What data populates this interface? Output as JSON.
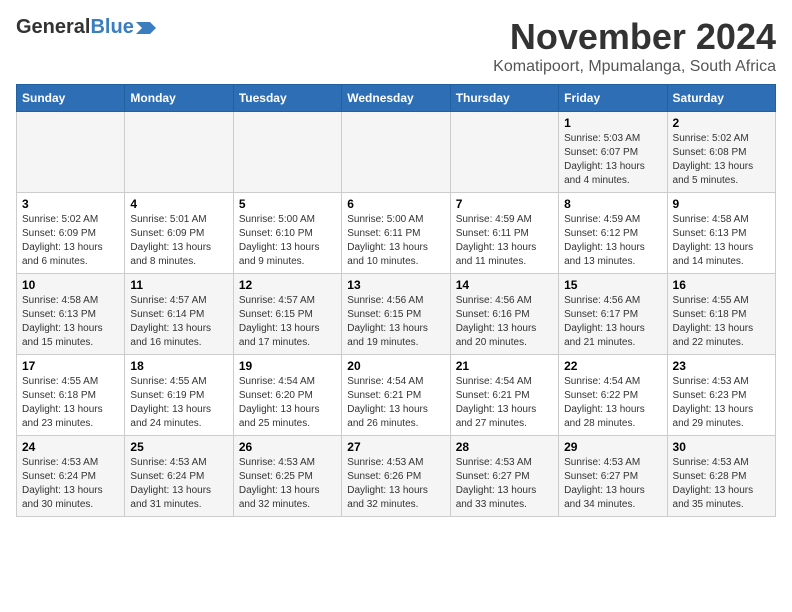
{
  "logo": {
    "part1": "General",
    "part2": "Blue"
  },
  "title": "November 2024",
  "subtitle": "Komatipoort, Mpumalanga, South Africa",
  "days_of_week": [
    "Sunday",
    "Monday",
    "Tuesday",
    "Wednesday",
    "Thursday",
    "Friday",
    "Saturday"
  ],
  "weeks": [
    [
      {
        "day": "",
        "detail": ""
      },
      {
        "day": "",
        "detail": ""
      },
      {
        "day": "",
        "detail": ""
      },
      {
        "day": "",
        "detail": ""
      },
      {
        "day": "",
        "detail": ""
      },
      {
        "day": "1",
        "detail": "Sunrise: 5:03 AM\nSunset: 6:07 PM\nDaylight: 13 hours\nand 4 minutes."
      },
      {
        "day": "2",
        "detail": "Sunrise: 5:02 AM\nSunset: 6:08 PM\nDaylight: 13 hours\nand 5 minutes."
      }
    ],
    [
      {
        "day": "3",
        "detail": "Sunrise: 5:02 AM\nSunset: 6:09 PM\nDaylight: 13 hours\nand 6 minutes."
      },
      {
        "day": "4",
        "detail": "Sunrise: 5:01 AM\nSunset: 6:09 PM\nDaylight: 13 hours\nand 8 minutes."
      },
      {
        "day": "5",
        "detail": "Sunrise: 5:00 AM\nSunset: 6:10 PM\nDaylight: 13 hours\nand 9 minutes."
      },
      {
        "day": "6",
        "detail": "Sunrise: 5:00 AM\nSunset: 6:11 PM\nDaylight: 13 hours\nand 10 minutes."
      },
      {
        "day": "7",
        "detail": "Sunrise: 4:59 AM\nSunset: 6:11 PM\nDaylight: 13 hours\nand 11 minutes."
      },
      {
        "day": "8",
        "detail": "Sunrise: 4:59 AM\nSunset: 6:12 PM\nDaylight: 13 hours\nand 13 minutes."
      },
      {
        "day": "9",
        "detail": "Sunrise: 4:58 AM\nSunset: 6:13 PM\nDaylight: 13 hours\nand 14 minutes."
      }
    ],
    [
      {
        "day": "10",
        "detail": "Sunrise: 4:58 AM\nSunset: 6:13 PM\nDaylight: 13 hours\nand 15 minutes."
      },
      {
        "day": "11",
        "detail": "Sunrise: 4:57 AM\nSunset: 6:14 PM\nDaylight: 13 hours\nand 16 minutes."
      },
      {
        "day": "12",
        "detail": "Sunrise: 4:57 AM\nSunset: 6:15 PM\nDaylight: 13 hours\nand 17 minutes."
      },
      {
        "day": "13",
        "detail": "Sunrise: 4:56 AM\nSunset: 6:15 PM\nDaylight: 13 hours\nand 19 minutes."
      },
      {
        "day": "14",
        "detail": "Sunrise: 4:56 AM\nSunset: 6:16 PM\nDaylight: 13 hours\nand 20 minutes."
      },
      {
        "day": "15",
        "detail": "Sunrise: 4:56 AM\nSunset: 6:17 PM\nDaylight: 13 hours\nand 21 minutes."
      },
      {
        "day": "16",
        "detail": "Sunrise: 4:55 AM\nSunset: 6:18 PM\nDaylight: 13 hours\nand 22 minutes."
      }
    ],
    [
      {
        "day": "17",
        "detail": "Sunrise: 4:55 AM\nSunset: 6:18 PM\nDaylight: 13 hours\nand 23 minutes."
      },
      {
        "day": "18",
        "detail": "Sunrise: 4:55 AM\nSunset: 6:19 PM\nDaylight: 13 hours\nand 24 minutes."
      },
      {
        "day": "19",
        "detail": "Sunrise: 4:54 AM\nSunset: 6:20 PM\nDaylight: 13 hours\nand 25 minutes."
      },
      {
        "day": "20",
        "detail": "Sunrise: 4:54 AM\nSunset: 6:21 PM\nDaylight: 13 hours\nand 26 minutes."
      },
      {
        "day": "21",
        "detail": "Sunrise: 4:54 AM\nSunset: 6:21 PM\nDaylight: 13 hours\nand 27 minutes."
      },
      {
        "day": "22",
        "detail": "Sunrise: 4:54 AM\nSunset: 6:22 PM\nDaylight: 13 hours\nand 28 minutes."
      },
      {
        "day": "23",
        "detail": "Sunrise: 4:53 AM\nSunset: 6:23 PM\nDaylight: 13 hours\nand 29 minutes."
      }
    ],
    [
      {
        "day": "24",
        "detail": "Sunrise: 4:53 AM\nSunset: 6:24 PM\nDaylight: 13 hours\nand 30 minutes."
      },
      {
        "day": "25",
        "detail": "Sunrise: 4:53 AM\nSunset: 6:24 PM\nDaylight: 13 hours\nand 31 minutes."
      },
      {
        "day": "26",
        "detail": "Sunrise: 4:53 AM\nSunset: 6:25 PM\nDaylight: 13 hours\nand 32 minutes."
      },
      {
        "day": "27",
        "detail": "Sunrise: 4:53 AM\nSunset: 6:26 PM\nDaylight: 13 hours\nand 32 minutes."
      },
      {
        "day": "28",
        "detail": "Sunrise: 4:53 AM\nSunset: 6:27 PM\nDaylight: 13 hours\nand 33 minutes."
      },
      {
        "day": "29",
        "detail": "Sunrise: 4:53 AM\nSunset: 6:27 PM\nDaylight: 13 hours\nand 34 minutes."
      },
      {
        "day": "30",
        "detail": "Sunrise: 4:53 AM\nSunset: 6:28 PM\nDaylight: 13 hours\nand 35 minutes."
      }
    ]
  ]
}
